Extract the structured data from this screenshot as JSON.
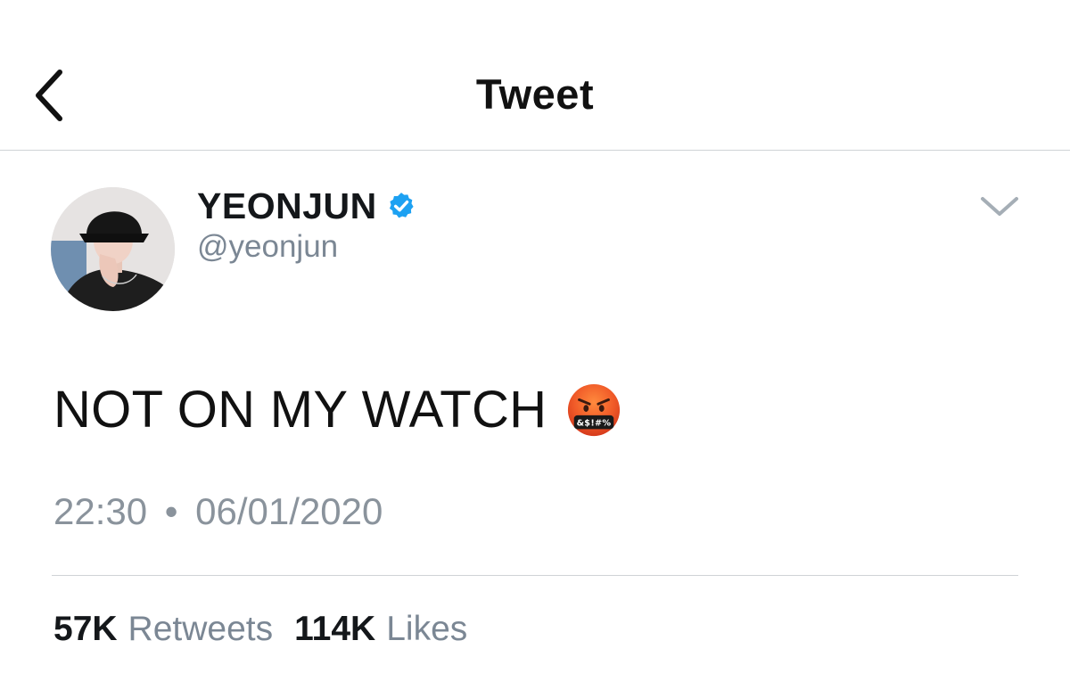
{
  "header": {
    "title": "Tweet",
    "back_icon": "chevron-left-icon"
  },
  "author": {
    "display_name": "YEONJUN",
    "handle": "@yeonjun",
    "verified": true,
    "verified_color": "#1da1f2",
    "avatar_icon": "profile-photo"
  },
  "tweet": {
    "text": "NOT ON MY WATCH",
    "emoji": "face-with-symbols-on-mouth",
    "emoji_symbols": "&$!#%",
    "time": "22:30",
    "separator": "•",
    "date": "06/01/2020"
  },
  "stats": {
    "retweets_count": "57K",
    "retweets_label": "Retweets",
    "likes_count": "114K",
    "likes_label": "Likes"
  },
  "menu": {
    "caret_icon": "chevron-down-icon"
  }
}
